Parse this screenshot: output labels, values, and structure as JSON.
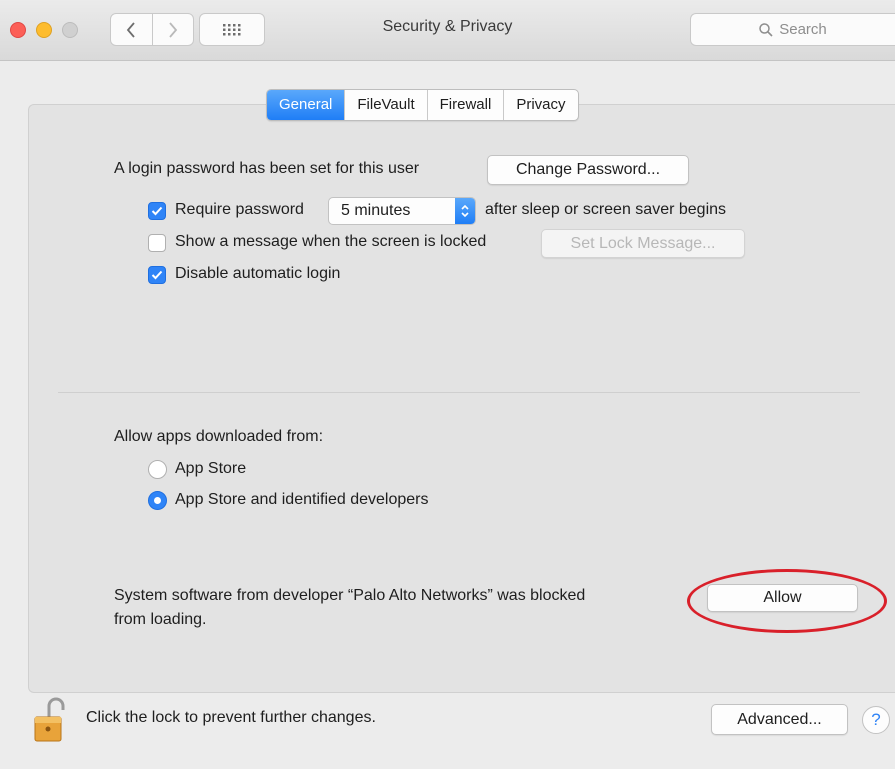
{
  "window": {
    "title": "Security & Privacy",
    "search_placeholder": "Search"
  },
  "tabs": [
    {
      "label": "General",
      "active": true
    },
    {
      "label": "FileVault",
      "active": false
    },
    {
      "label": "Firewall",
      "active": false
    },
    {
      "label": "Privacy",
      "active": false
    }
  ],
  "general": {
    "login_password_text": "A login password has been set for this user",
    "change_password_label": "Change Password...",
    "require_password": {
      "checked": true,
      "label": "Require password",
      "value": "5 minutes",
      "suffix": "after sleep or screen saver begins"
    },
    "show_message": {
      "checked": false,
      "label": "Show a message when the screen is locked",
      "button_label": "Set Lock Message..."
    },
    "disable_auto_login": {
      "checked": true,
      "label": "Disable automatic login"
    }
  },
  "gatekeeper": {
    "heading": "Allow apps downloaded from:",
    "options": [
      {
        "label": "App Store",
        "selected": false
      },
      {
        "label": "App Store and identified developers",
        "selected": true
      }
    ]
  },
  "blocked": {
    "line1": "System software from developer “Palo Alto Networks” was blocked",
    "line2": "from loading.",
    "allow_label": "Allow"
  },
  "footer": {
    "lock_text": "Click the lock to prevent further changes.",
    "advanced_label": "Advanced...",
    "help_label": "?"
  },
  "colors": {
    "accent": "#2f84f7",
    "annotation": "#d9202a"
  }
}
